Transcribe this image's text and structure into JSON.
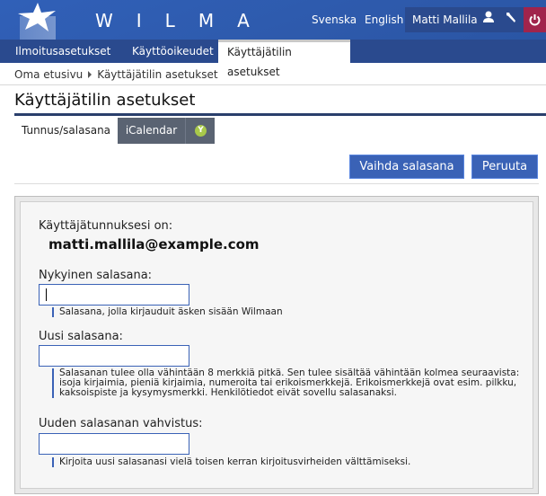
{
  "header": {
    "brand": "WILMA",
    "languages": [
      "Svenska",
      "English"
    ],
    "user_name": "Matti Mallila",
    "icons": [
      "star-logo-icon",
      "user-icon",
      "wrench-icon",
      "power-icon"
    ]
  },
  "nav": {
    "tabs": [
      {
        "label": "Ilmoitusasetukset",
        "active": false
      },
      {
        "label": "Käyttöoikeudet",
        "active": false
      },
      {
        "label": "Käyttäjätilin asetukset",
        "active": true
      }
    ]
  },
  "breadcrumb": {
    "items": [
      "Oma etusivu",
      "Käyttäjätilin asetukset"
    ]
  },
  "page": {
    "title": "Käyttäjätilin asetukset",
    "subtabs": [
      {
        "label": "Tunnus/salasana",
        "active": true
      },
      {
        "label": "iCalendar",
        "active": false
      },
      {
        "label": "Y",
        "icon": "yammer-icon"
      }
    ],
    "buttons": {
      "change_password": "Vaihda salasana",
      "cancel": "Peruuta"
    }
  },
  "form": {
    "username_label": "Käyttäjätunnuksesi on:",
    "username_value": "matti.mallila@example.com",
    "current_password": {
      "label": "Nykyinen salasana:",
      "value": "",
      "hint": "Salasana, jolla kirjauduit äsken sisään Wilmaan"
    },
    "new_password": {
      "label": "Uusi salasana:",
      "value": "",
      "hint": "Salasanan tulee olla vähintään 8 merkkiä pitkä. Sen tulee sisältää vähintään kolmea seuraavista: isoja kirjaimia, pieniä kirjaimia, numeroita tai erikoismerkkejä. Erikoismerkkejä ovat esim. pilkku, kaksoispiste ja kysymysmerkki. Henkilötiedot eivät sovellu salasanaksi."
    },
    "confirm_password": {
      "label": "Uuden salasanan vahvistus:",
      "value": "",
      "hint": "Kirjoita uusi salasanasi vielä toisen kerran kirjoitusvirheiden välttämiseksi."
    }
  },
  "colors": {
    "header_blue": "#2e5aac",
    "nav_dark": "#2a4a8e",
    "button_blue": "#3a62b6",
    "logout_red": "#a0244c",
    "subtab_gray": "#5a6372"
  }
}
